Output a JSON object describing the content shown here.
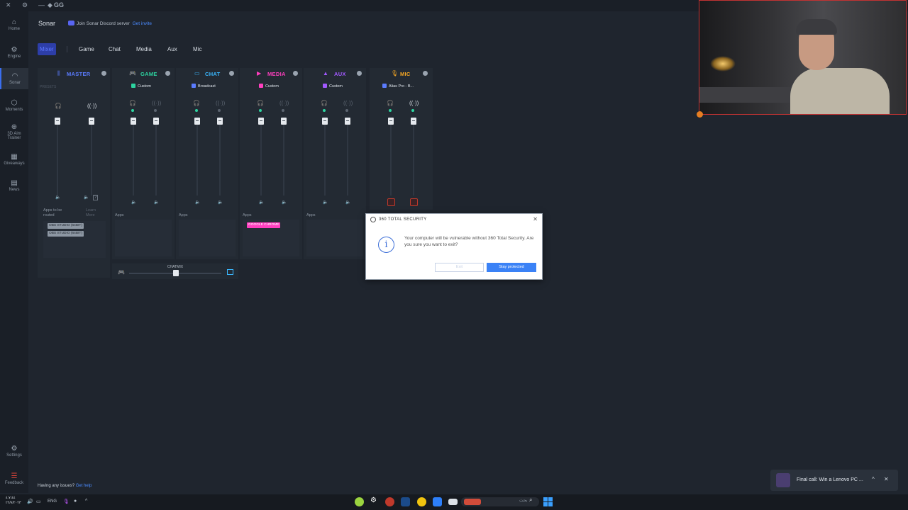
{
  "titlebar": {
    "app": "GG",
    "close_glyph": "✕",
    "settings_glyph": "⚙",
    "min_glyph": "—"
  },
  "sidebar": {
    "items": [
      {
        "label": "Home",
        "icon": "home-icon"
      },
      {
        "label": "Engine",
        "icon": "engine-icon"
      },
      {
        "label": "Sonar",
        "icon": "sonar-icon",
        "active": true
      },
      {
        "label": "Moments",
        "icon": "moments-icon"
      },
      {
        "label": "3D Aim Trainer",
        "icon": "aim-icon"
      },
      {
        "label": "Giveaways",
        "icon": "gift-icon"
      },
      {
        "label": "News",
        "icon": "news-icon"
      }
    ],
    "bottom": [
      {
        "label": "Settings",
        "icon": "settings-icon"
      },
      {
        "label": "Feedback",
        "icon": "feedback-icon"
      }
    ]
  },
  "header": {
    "title": "Sonar",
    "discord_text": "Join Sonar Discord server",
    "discord_link": "Get invite"
  },
  "tabs": [
    "Mixer",
    "Game",
    "Chat",
    "Media",
    "Aux",
    "Mic"
  ],
  "mixer": {
    "presets_label": "PRESETS",
    "apps_label": "Apps",
    "master": {
      "name": "MASTER",
      "apps_to_be_routed": "Apps to be routed",
      "learn_more": "Learn More",
      "chips": [
        "OBS STUDIO (64BIT)",
        "OBS STUDIO (64BIT)"
      ]
    },
    "channels": [
      {
        "name": "GAME",
        "preset": "Custom",
        "color": "#2dd4a0"
      },
      {
        "name": "CHAT",
        "preset": "Broadcast",
        "color": "#3ab8ff"
      },
      {
        "name": "MEDIA",
        "preset": "Custom",
        "color": "#ff3fbf"
      },
      {
        "name": "AUX",
        "preset": "Custom",
        "color": "#a259ff"
      },
      {
        "name": "MIC",
        "preset": "Alias Pro - B...",
        "color": "#f5a623"
      }
    ],
    "media_chip": "GOOGLE CHROME",
    "chatmix_label": "CHATMIX"
  },
  "dialog": {
    "title": "360 TOTAL SECURITY",
    "message": "Your computer will be vulnerable without 360 Total Security. Are you sure you want to exit?",
    "exit_label": "Exit",
    "stay_label": "Stay protected",
    "info_glyph": "i",
    "close_glyph": "✕"
  },
  "footer": {
    "issues_text": "Having any issues?",
    "issues_link": "Get help"
  },
  "toast": {
    "text": "Final call: Win a Lenovo PC ...",
    "up_glyph": "^",
    "close_glyph": "✕"
  },
  "taskbar": {
    "time": "٤:٧:٤٤",
    "date": "٢٢/٧/٢٠٢٣",
    "lang": "ENG",
    "search_text": "بحث"
  }
}
